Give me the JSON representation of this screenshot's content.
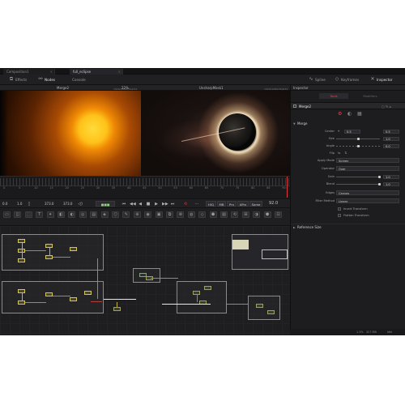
{
  "tabs": [
    {
      "label": "Composition1",
      "active": false
    },
    {
      "label": "full_eclipse",
      "active": true
    }
  ],
  "modebar": {
    "effects_label": "Effects",
    "nodes_label": "Nodes",
    "console_label": "Console",
    "spline_label": "Spline",
    "keyframes_label": "Keyframes",
    "inspector_label": "Inspector"
  },
  "viewer": {
    "left_node": "Merge2",
    "left_res": "1920x1080xfloat32",
    "left_zoom": "22%",
    "right_node": "UnsharpMask1",
    "right_res": "1920x1080xfloat32"
  },
  "ruler": {
    "labels": [
      "0",
      "5",
      "10",
      "15",
      "20",
      "25",
      "30",
      "35",
      "40",
      "45",
      "50",
      "55",
      "60",
      "65",
      "70",
      "75",
      "80",
      "85",
      "90"
    ],
    "playhead_frame": 92
  },
  "transport": {
    "start": "0.0",
    "render_start": "1.0",
    "render_end": "373.0",
    "end": "373.0",
    "hiq": "HiQ",
    "mb": "MB",
    "prx": "Prx",
    "aprx": "APrx",
    "some": "Some",
    "current_frame": "92.0"
  },
  "inspector": {
    "header": "Inspector",
    "tools_tab": "Tools",
    "modifiers_tab": "Modifiers",
    "node_name": "Merge2",
    "merge_section": "Merge",
    "center_label": "Center",
    "center_x": "0.5",
    "center_y": "0.5",
    "size_label": "Size",
    "size_value": "1.0",
    "size_frac": 0.5,
    "angle_label": "Angle",
    "angle_value": "0.0",
    "angle_frac": 0.5,
    "flip_label": "Flip",
    "apply_mode_label": "Apply Mode",
    "apply_mode_value": "Screen",
    "operator_label": "Operator",
    "operator_value": "Over",
    "gain_label": "Gain",
    "gain_value": "1.0",
    "gain_frac": 1.0,
    "blend_label": "Blend",
    "blend_value": "1.0",
    "blend_frac": 1.0,
    "edges_label": "Edges",
    "edges_value": "Canvas",
    "filter_method_label": "Filter Method",
    "filter_method_value": "Linear",
    "invert_transform_label": "Invert Transform",
    "flatten_transform_label": "Flatten Transform",
    "reference_size_section": "Reference Size"
  },
  "status": {
    "memory": "1.3%",
    "memory_detail": "327 MB",
    "fps": "Idle"
  },
  "colors": {
    "accent_red": "#d83b3b",
    "node_yellow": "#d8c84a",
    "panel_bg": "#1c1c1f"
  }
}
